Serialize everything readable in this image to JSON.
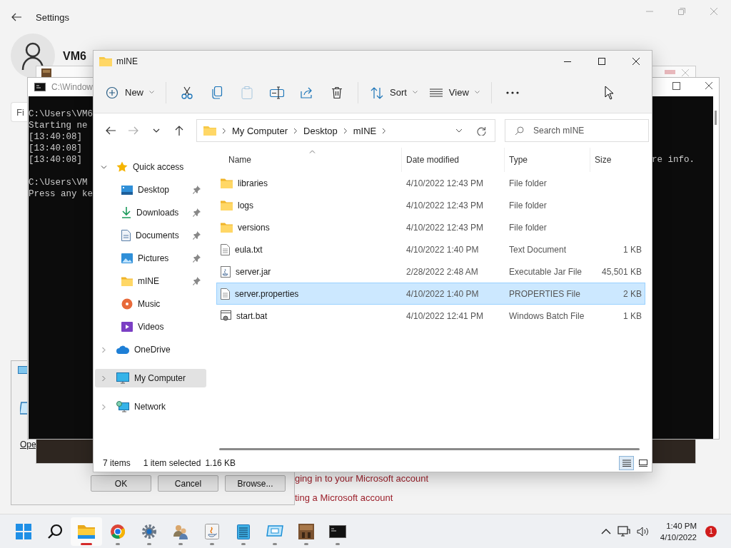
{
  "settings": {
    "title": "Settings",
    "account_name": "VM6",
    "search_placeholder": "Fi",
    "links": [
      "ging in to your Microsoft account",
      "ting a Microsoft account"
    ]
  },
  "dialog": {
    "label": "Ope",
    "buttons": [
      "OK",
      "Cancel",
      "Browse..."
    ]
  },
  "console": {
    "title": "C:\\Window",
    "blocks": [
      [
        "C:\\Users\\VM6",
        "Starting ne",
        "[13:40:08]",
        "[13:40:08]",
        "[13:40:08]"
      ],
      [
        "C:\\Users\\VM",
        "Press any ke"
      ]
    ],
    "right_text": "re info."
  },
  "explorer": {
    "title": "mINE",
    "toolbar": [
      [
        {
          "kind": "new",
          "label": "New",
          "disabled": false
        }
      ],
      [
        {
          "kind": "cut",
          "disabled": false
        },
        {
          "kind": "copy",
          "disabled": false
        },
        {
          "kind": "paste",
          "disabled": true
        },
        {
          "kind": "rename",
          "disabled": false
        },
        {
          "kind": "share",
          "disabled": false
        },
        {
          "kind": "delete",
          "disabled": false
        }
      ],
      [
        {
          "kind": "sort",
          "label": "Sort",
          "disabled": false
        },
        {
          "kind": "view",
          "label": "View",
          "disabled": false
        }
      ],
      [
        {
          "kind": "more",
          "disabled": false
        }
      ]
    ],
    "nav_buttons": [
      {
        "kind": "back",
        "disabled": false
      },
      {
        "kind": "forward",
        "disabled": true
      },
      {
        "kind": "recent",
        "disabled": false
      },
      {
        "kind": "up",
        "disabled": false
      }
    ],
    "breadcrumbs": [
      "My Computer",
      "Desktop",
      "mINE"
    ],
    "search": {
      "placeholder": "Search mINE"
    },
    "nav": [
      {
        "label": "Quick access",
        "kind": "star",
        "expanded": true,
        "selected": false,
        "children": [
          {
            "label": "Desktop",
            "kind": "desktop",
            "pinned": true,
            "selected": false
          },
          {
            "label": "Downloads",
            "kind": "download",
            "pinned": true,
            "selected": false
          },
          {
            "label": "Documents",
            "kind": "document",
            "pinned": true,
            "selected": false
          },
          {
            "label": "Pictures",
            "kind": "picture",
            "pinned": true,
            "selected": false
          },
          {
            "label": "mINE",
            "kind": "folder",
            "pinned": true,
            "selected": false
          },
          {
            "label": "Music",
            "kind": "music",
            "pinned": false,
            "selected": false
          },
          {
            "label": "Videos",
            "kind": "video",
            "pinned": false,
            "selected": false
          }
        ]
      },
      {
        "label": "OneDrive",
        "kind": "cloud",
        "expanded": false,
        "selected": false
      },
      {
        "label": "My Computer",
        "kind": "computer",
        "expanded": false,
        "selected": true
      },
      {
        "label": "Network",
        "kind": "network",
        "expanded": false,
        "selected": false
      }
    ],
    "columns": [
      {
        "label": "Name",
        "sorted": true
      },
      {
        "label": "Date modified",
        "sorted": false
      },
      {
        "label": "Type",
        "sorted": false
      },
      {
        "label": "Size",
        "sorted": false
      }
    ],
    "files": [
      {
        "name": "libraries",
        "kind": "folder",
        "date": "4/10/2022 12:43 PM",
        "type": "File folder",
        "selected": false
      },
      {
        "name": "logs",
        "kind": "folder",
        "date": "4/10/2022 12:43 PM",
        "type": "File folder",
        "selected": false
      },
      {
        "name": "versions",
        "kind": "folder",
        "date": "4/10/2022 12:43 PM",
        "type": "File folder",
        "selected": false
      },
      {
        "name": "eula.txt",
        "kind": "text",
        "date": "4/10/2022 1:40 PM",
        "type": "Text Document",
        "size": "1 KB",
        "selected": false
      },
      {
        "name": "server.jar",
        "kind": "jar",
        "date": "2/28/2022 2:48 AM",
        "type": "Executable Jar File",
        "size": "45,501 KB",
        "selected": false
      },
      {
        "name": "server.properties",
        "kind": "text",
        "date": "4/10/2022 1:40 PM",
        "type": "PROPERTIES File",
        "size": "2 KB",
        "selected": true
      },
      {
        "name": "start.bat",
        "kind": "bat",
        "date": "4/10/2022 12:41 PM",
        "type": "Windows Batch File",
        "size": "1 KB",
        "selected": false
      }
    ],
    "status": {
      "items": "7 items",
      "selection": "1 item selected",
      "selection_size": "1.16 KB"
    },
    "view_buttons": [
      {
        "kind": "details",
        "selected": true
      },
      {
        "kind": "tiles",
        "selected": false
      }
    ]
  },
  "taskbar": {
    "apps": [
      {
        "kind": "start",
        "running": false,
        "active": false
      },
      {
        "kind": "search",
        "running": false,
        "active": false
      },
      {
        "kind": "explorer",
        "running": true,
        "active": true
      },
      {
        "kind": "chrome",
        "running": true,
        "active": false
      },
      {
        "kind": "settings",
        "running": true,
        "active": false
      },
      {
        "kind": "users",
        "running": true,
        "active": false
      },
      {
        "kind": "java",
        "running": true,
        "active": false
      },
      {
        "kind": "notepad",
        "running": true,
        "active": false
      },
      {
        "kind": "display",
        "running": true,
        "active": false
      },
      {
        "kind": "minecraft",
        "running": true,
        "active": false
      },
      {
        "kind": "terminal",
        "running": true,
        "active": false
      }
    ],
    "time": "1:40 PM",
    "date": "4/10/2022",
    "badge": "1"
  }
}
